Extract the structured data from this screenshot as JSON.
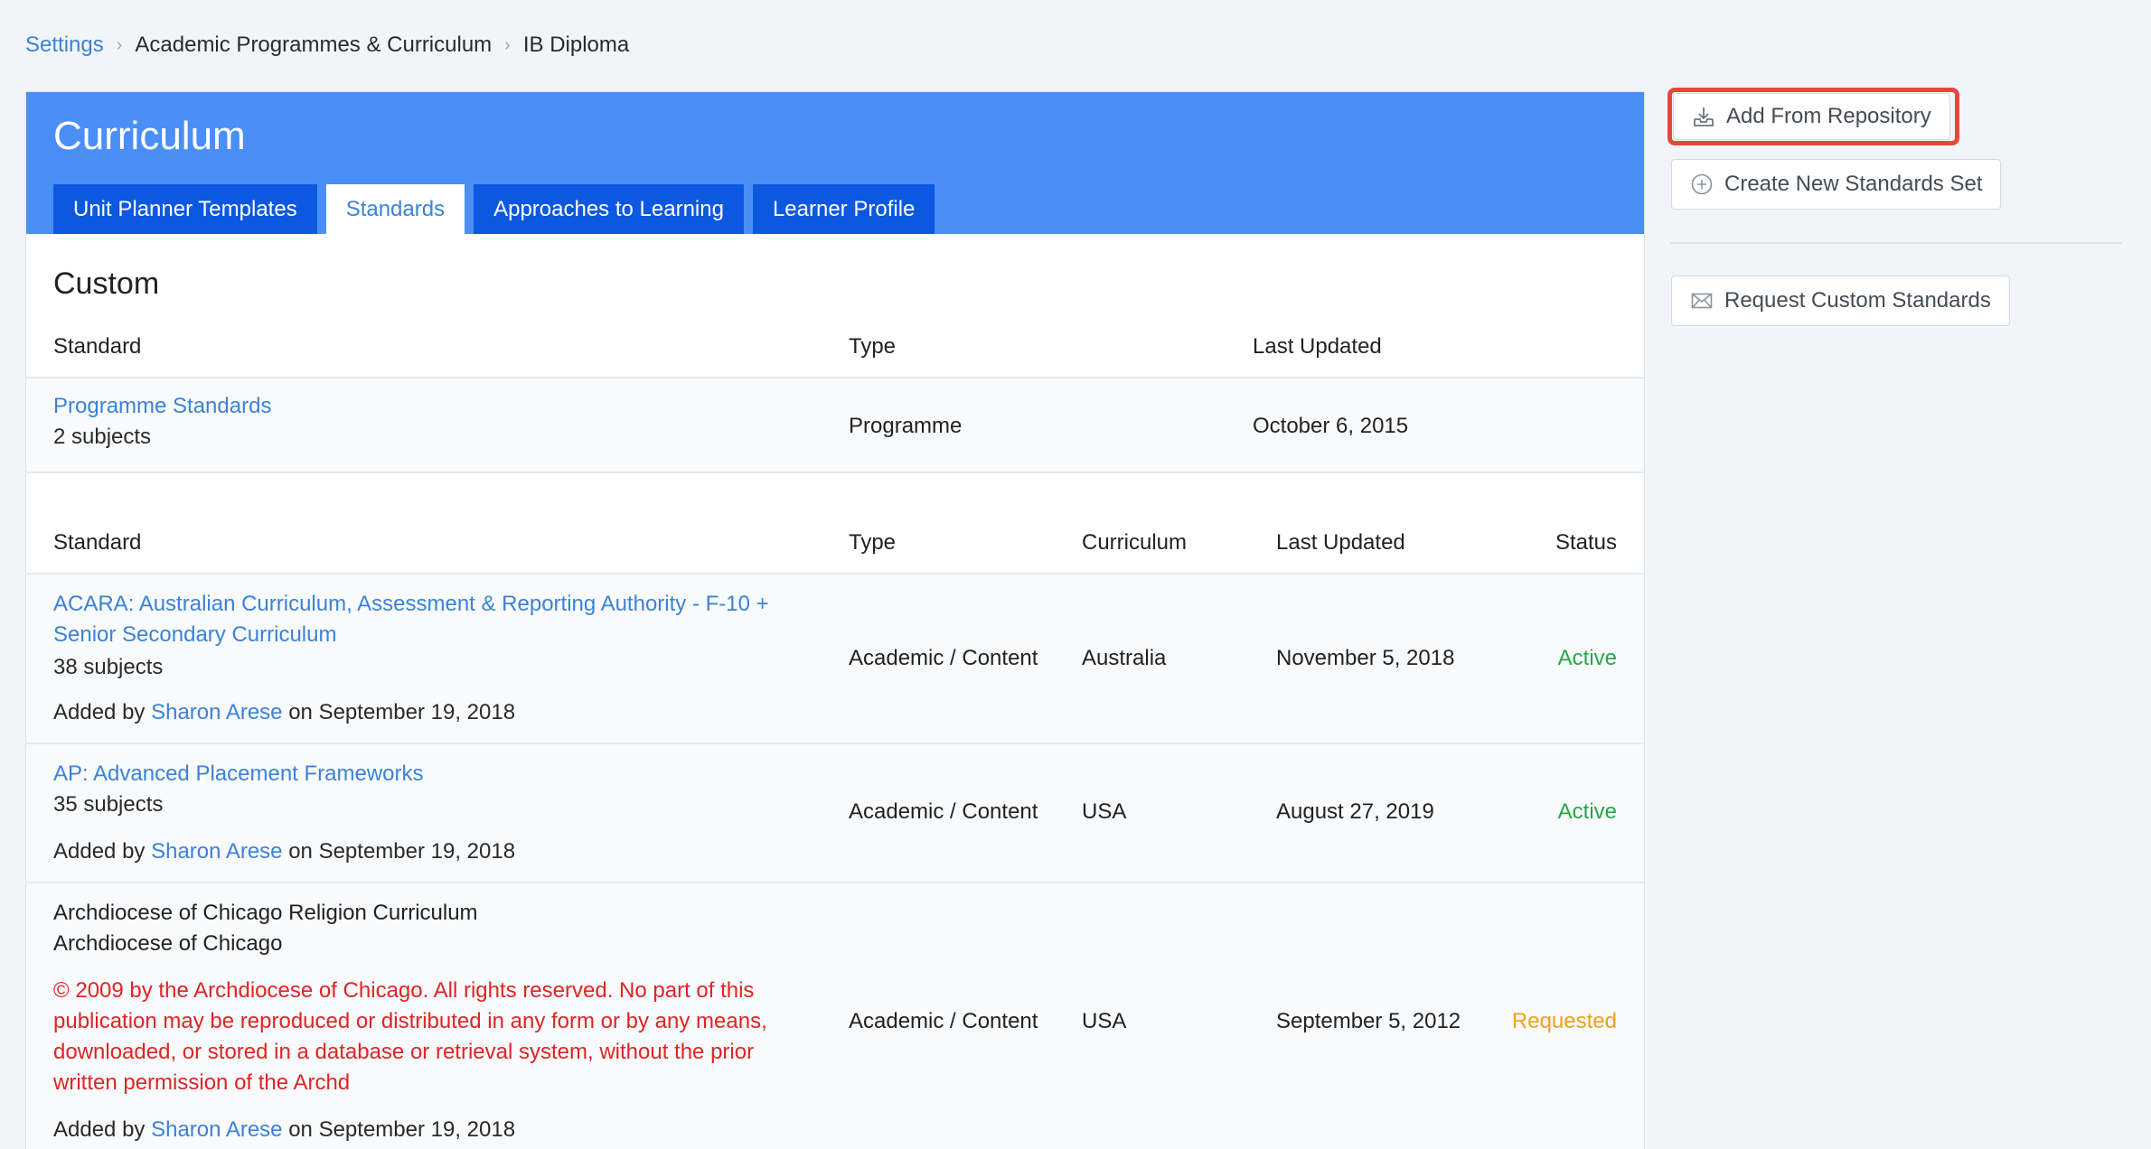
{
  "breadcrumb": {
    "settings": "Settings",
    "academic": "Academic Programmes & Curriculum",
    "programme": "IB Diploma",
    "separator": "›"
  },
  "header": {
    "title": "Curriculum",
    "tabs": [
      "Unit Planner Templates",
      "Standards",
      "Approaches to Learning",
      "Learner Profile"
    ],
    "active_tab": "Standards"
  },
  "custom": {
    "title": "Custom",
    "columns": {
      "standard": "Standard",
      "type": "Type",
      "last_updated": "Last Updated"
    },
    "row": {
      "name": "Programme Standards",
      "subjects": "2 subjects",
      "type": "Programme",
      "last_updated": "October 6, 2015"
    }
  },
  "repo": {
    "columns": {
      "standard": "Standard",
      "type": "Type",
      "curriculum": "Curriculum",
      "last_updated": "Last Updated",
      "status": "Status"
    },
    "added_by_prefix": "Added by",
    "added_on_prefix": "on",
    "rows": [
      {
        "name_line1": "ACARA: Australian Curriculum, Assessment & Reporting Authority - F-10 +",
        "name_line2": "Senior Secondary Curriculum",
        "subjects": "38 subjects",
        "added_by": "Sharon Arese",
        "added_on": "September 19, 2018",
        "type": "Academic / Content",
        "curriculum": "Australia",
        "last_updated": "November 5, 2018",
        "status": "Active"
      },
      {
        "name_line1": "AP: Advanced Placement Frameworks",
        "subjects": "35 subjects",
        "added_by": "Sharon Arese",
        "added_on": "September 19, 2018",
        "type": "Academic / Content",
        "curriculum": "USA",
        "last_updated": "August 27, 2019",
        "status": "Active"
      },
      {
        "name_line1": "Archdiocese of Chicago Religion Curriculum",
        "owner": "Archdiocese of Chicago",
        "copyright_lines": [
          "© 2009 by the Archdiocese of Chicago. All rights reserved. No part of this",
          "publication may be reproduced or distributed in any form or by any means,",
          "downloaded, or stored in a database or retrieval system, without the prior",
          "written permission of the Archd"
        ],
        "added_by": "Sharon Arese",
        "added_on": "September 19, 2018",
        "type": "Academic / Content",
        "curriculum": "USA",
        "last_updated": "September 5, 2012",
        "status": "Requested"
      }
    ]
  },
  "sidebar": {
    "add_from_repository": "Add From Repository",
    "create_new_set": "Create New Standards Set",
    "request_custom": "Request Custom Standards"
  },
  "colors": {
    "header_blue": "#4a8ef7",
    "tab_blue": "#0c58e0",
    "link_blue": "#3b82d8",
    "active_green": "#28a745",
    "requested_orange": "#f0a01c",
    "warning_red": "#e02424",
    "highlight_red": "#e9463a"
  },
  "icons": {
    "add_from_repository": "download-tray-icon",
    "create_new_set": "plus-circle-icon",
    "request_custom": "envelope-icon"
  }
}
